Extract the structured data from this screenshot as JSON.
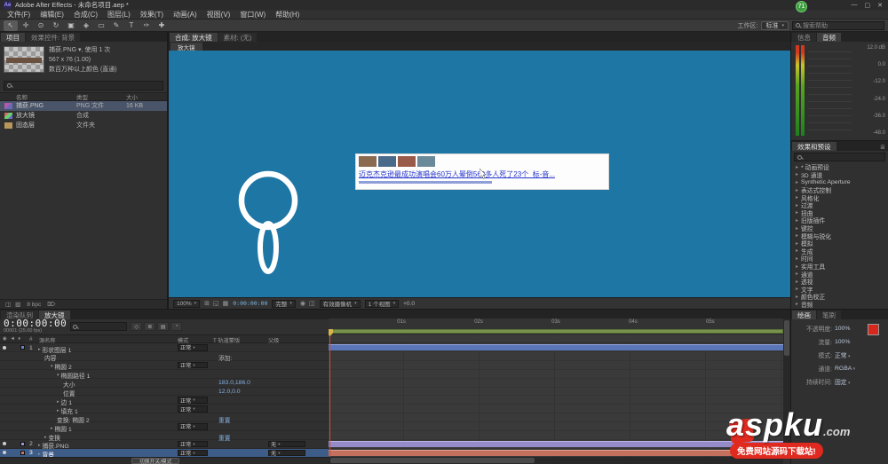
{
  "window": {
    "title": "Adobe After Effects - 未命名项目.aep *",
    "logo": "Ae",
    "badge": "71",
    "min": "—",
    "max": "▢",
    "close": "✕"
  },
  "menu": [
    "文件(F)",
    "编辑(E)",
    "合成(C)",
    "图层(L)",
    "效果(T)",
    "动画(A)",
    "视图(V)",
    "窗口(W)",
    "帮助(H)"
  ],
  "toolbar": {
    "tools": [
      {
        "id": "selection-tool",
        "glyph": "↖"
      },
      {
        "id": "hand-tool",
        "glyph": "✛"
      },
      {
        "id": "zoom-tool",
        "glyph": "⊙"
      },
      {
        "id": "rotation-tool",
        "glyph": "↻"
      },
      {
        "id": "camera-tool",
        "glyph": "▣"
      },
      {
        "id": "pan-behind-tool",
        "glyph": "◈"
      },
      {
        "id": "shape-tool",
        "glyph": "▭"
      },
      {
        "id": "pen-tool",
        "glyph": "✎"
      },
      {
        "id": "type-tool",
        "glyph": "T"
      },
      {
        "id": "brush-tool",
        "glyph": "✑"
      },
      {
        "id": "puppet-pin-tool",
        "glyph": "✚"
      }
    ],
    "workspace_label": "工作区:",
    "workspace_value": "标准",
    "search_text": "搜索帮助"
  },
  "project": {
    "tabs": [
      {
        "label": "项目",
        "active": true
      },
      {
        "label": "效果控件: 背景",
        "active": false
      }
    ],
    "preview": {
      "name": "捕获.PNG ▾, 使用 1 次",
      "dims": "567 x 76 (1.00)",
      "color_info": "数百万种以上颜色 (直通)"
    },
    "columns": [
      "名称",
      "类型",
      "大小"
    ],
    "items": [
      {
        "name": "捕获.PNG",
        "type": "PNG 文件",
        "size": "16 KB",
        "icon": "image",
        "selected": true
      },
      {
        "name": "放大镜",
        "type": "合成",
        "size": "",
        "icon": "comp"
      },
      {
        "name": "固态层",
        "type": "文件夹",
        "size": "",
        "icon": "folder"
      }
    ],
    "footer_icons": [
      "◫",
      "▧"
    ],
    "footer_bpc": "8 bpc",
    "footer_trash": "⌦"
  },
  "viewer": {
    "tabs": [
      {
        "label": "合成: 放大镜",
        "active": true
      },
      {
        "label": "素材: (无)",
        "active": false
      }
    ],
    "comp_tab": "放大镜",
    "news": {
      "headline": "迈克杰克逊最成功演唱会60万人晕倒560多人死了23个_标-音...",
      "thumb_colors": [
        "#8a6a4f",
        "#4a6a8a",
        "#9a5a4a",
        "#6a8a9a"
      ]
    },
    "controls": {
      "zoom": "100%",
      "timecode": "0:00:00:00",
      "res": "完整",
      "camera": "有效摄像机",
      "views": "1 个视图",
      "exposure": "+0.0"
    },
    "icons_a": [
      "⊞",
      "◱",
      "▦"
    ],
    "icons_b": [
      "◉",
      "◫"
    ]
  },
  "audio": {
    "tabs": [
      {
        "label": "信息",
        "active": false
      },
      {
        "label": "音频",
        "active": true
      }
    ],
    "scale": [
      "12.0 dB",
      "0.0",
      "-12.0",
      "-24.0",
      "-36.0",
      "-48.0"
    ]
  },
  "effects": {
    "tab": "效果和预设",
    "menu_icon": "≣",
    "items": [
      "* 动画预设",
      "3D 通道",
      "Synthetic Aperture",
      "表达式控制",
      "风格化",
      "过渡",
      "扭曲",
      "旧版插件",
      "键控",
      "模糊与锐化",
      "模拟",
      "生成",
      "时间",
      "实用工具",
      "通道",
      "透视",
      "文字",
      "颜色校正",
      "音频"
    ]
  },
  "timeline": {
    "tabs": [
      {
        "label": "渲染队列",
        "active": false
      },
      {
        "label": "放大镜",
        "active": true
      }
    ],
    "timecode": "0:00:00:00",
    "frame_info": "00001 (25.00 fps)",
    "info_icons": [
      "◇",
      "≣",
      "▤",
      "◔"
    ],
    "columns": {
      "icons": "◉ ◄ ♦",
      "num": "#",
      "source": "源名称",
      "mode": "模式",
      "matte": "T 轨道蒙版",
      "parent": "父级"
    },
    "ruler": [
      "01s",
      "02s",
      "03s",
      "04s",
      "05s"
    ],
    "rows": [
      {
        "num": "1",
        "name": "形状图层 1",
        "twirl": "▸",
        "mode": "正常",
        "indent": 0,
        "bar": "blue",
        "icons": "layer"
      },
      {
        "name": "内容",
        "extra": "添加:",
        "indent": 1
      },
      {
        "name": "椭圆 2",
        "twirl": "▾",
        "mode": "正常",
        "indent": 2
      },
      {
        "name": "椭圆路径 1",
        "twirl": "▾",
        "indent": 3
      },
      {
        "name": "大小",
        "value": "183.0,186.0",
        "indent": 4
      },
      {
        "name": "位置",
        "value": "12.0,0.0",
        "indent": 4
      },
      {
        "name": "边 1",
        "twirl": "▸",
        "mode": "正常",
        "indent": 3
      },
      {
        "name": "填充 1",
        "twirl": "▸",
        "mode": "正常",
        "indent": 3
      },
      {
        "name": "变换: 椭圆 2",
        "value": "重置",
        "indent": 3
      },
      {
        "name": "椭圆 1",
        "twirl": "▸",
        "mode": "正常",
        "indent": 2
      },
      {
        "name": "变换",
        "twirl": "▸",
        "value": "重置",
        "indent": 1
      },
      {
        "num": "2",
        "name": "捕获.PNG",
        "twirl": "▸",
        "mode": "正常",
        "parent": "无",
        "indent": 0,
        "bar": "purple",
        "icons": "layer"
      },
      {
        "num": "3",
        "name": "背景",
        "twirl": "▸",
        "mode": "正常",
        "parent": "无",
        "indent": 0,
        "bar": "red",
        "selected": true,
        "icons": "layer"
      }
    ],
    "footer_button": "切换开关/模式"
  },
  "paint": {
    "tabs": [
      {
        "label": "绘画",
        "active": true
      },
      {
        "label": "笔刷",
        "active": false
      }
    ],
    "rows": [
      {
        "label": "不透明度:",
        "value": "100%"
      },
      {
        "label": "流量:",
        "value": "100%"
      },
      {
        "label": "模式:",
        "value": "正常",
        "dd": true
      },
      {
        "label": "通道:",
        "value": "RGBA",
        "dd": true
      },
      {
        "label": "持续时间:",
        "value": "固定",
        "dd": true
      }
    ]
  },
  "watermark": {
    "brand": "aspku",
    "tld": ".com",
    "slogan": "免费网站源码下载站!"
  }
}
